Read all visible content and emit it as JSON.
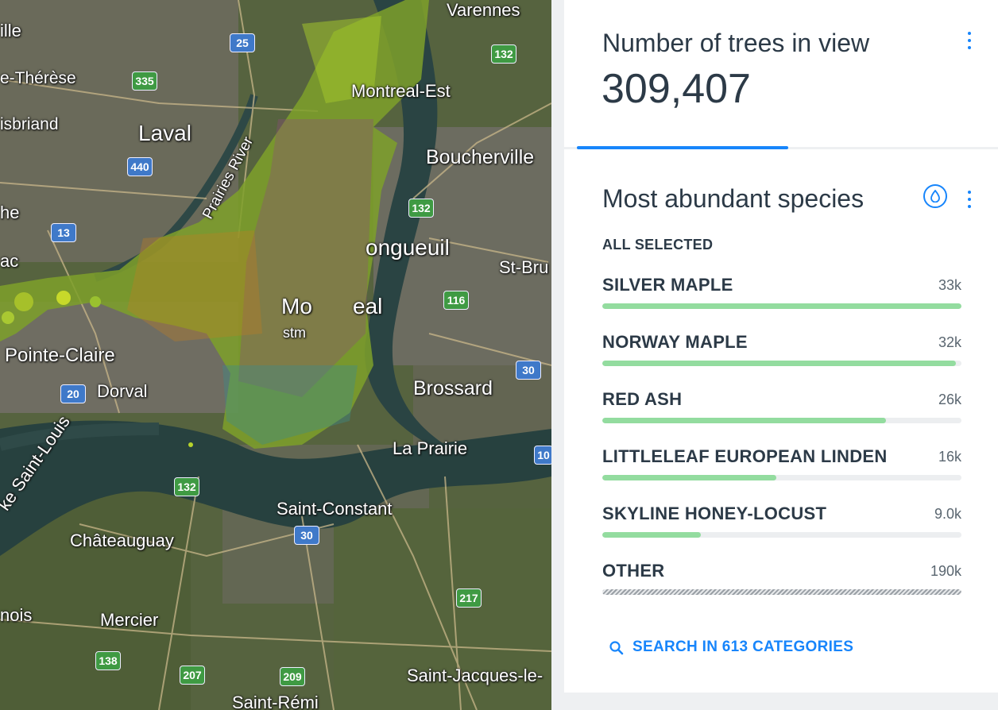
{
  "map": {
    "places": [
      "ille",
      "e-Thérèse",
      "isbriand",
      "Laval",
      "he",
      "ac",
      "Varennes",
      "Montreal-Est",
      "Boucherville",
      "ongueuil",
      "St-Bru",
      "Mo",
      "eal",
      "stm",
      "Pointe-Claire",
      "Dorval",
      "Brossard",
      "La Prairie",
      "Saint-Constant",
      "Châteauguay",
      "Mercier",
      "nois",
      "Saint-Jacques-le-",
      "Saint-Rémi",
      "ke Saint-Louis",
      "Prairies River"
    ],
    "shields": [
      "25",
      "132",
      "335",
      "440",
      "13",
      "132",
      "116",
      "30",
      "20",
      "132",
      "30",
      "217",
      "138",
      "207",
      "209",
      "10"
    ]
  },
  "count_widget": {
    "title": "Number of trees in view",
    "value": "309,407",
    "progress": 0.5
  },
  "species_widget": {
    "title": "Most abundant species",
    "subtitle": "ALL SELECTED",
    "rows": [
      {
        "name": "SILVER MAPLE",
        "value": "33k",
        "fraction": 1.0
      },
      {
        "name": "NORWAY MAPLE",
        "value": "32k",
        "fraction": 0.985
      },
      {
        "name": "RED ASH",
        "value": "26k",
        "fraction": 0.79
      },
      {
        "name": "LITTLELEAF EUROPEAN LINDEN",
        "value": "16k",
        "fraction": 0.485
      },
      {
        "name": "SKYLINE HONEY-LOCUST",
        "value": "9.0k",
        "fraction": 0.275
      },
      {
        "name": "OTHER",
        "value": "190k",
        "fraction": 1.0
      }
    ],
    "search_label": "SEARCH IN 613 CATEGORIES"
  },
  "colors": {
    "accent": "#1785fb",
    "bar": "#93dc9f",
    "text": "#2c3a47"
  },
  "icons": [
    "kebab-menu-icon",
    "droplet-icon",
    "search-icon"
  ]
}
